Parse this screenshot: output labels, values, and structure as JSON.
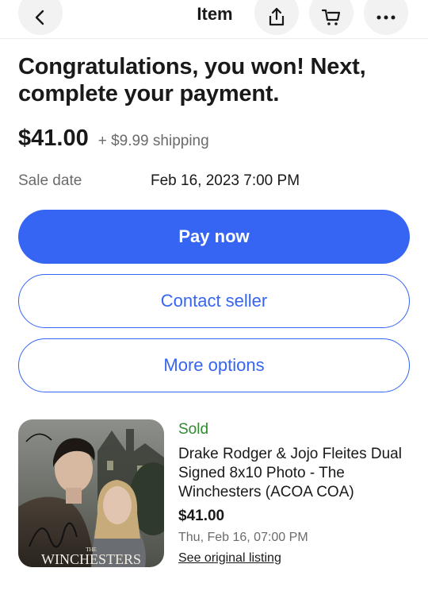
{
  "header": {
    "title": "Item"
  },
  "headline": "Congratulations, you won! Next, complete your payment.",
  "price": {
    "amount": "$41.00",
    "shipping": "+ $9.99 shipping"
  },
  "sale": {
    "label": "Sale date",
    "value": "Feb 16, 2023 7:00 PM"
  },
  "buttons": {
    "pay": "Pay now",
    "contact": "Contact seller",
    "more": "More options"
  },
  "item": {
    "status": "Sold",
    "title": "Drake Rodger & Jojo Fleites Dual Signed 8x10 Photo - The Winchesters (ACOA COA)",
    "price": "$41.00",
    "date": "Thu, Feb 16, 07:00 PM",
    "link": "See original listing",
    "image_caption_small": "THE",
    "image_caption": "WINCHESTERS"
  },
  "colors": {
    "accent": "#3665f3",
    "success": "#2f8a30",
    "muted": "#6b6b6b"
  },
  "icons": [
    "back-icon",
    "share-icon",
    "cart-icon",
    "more-icon"
  ]
}
